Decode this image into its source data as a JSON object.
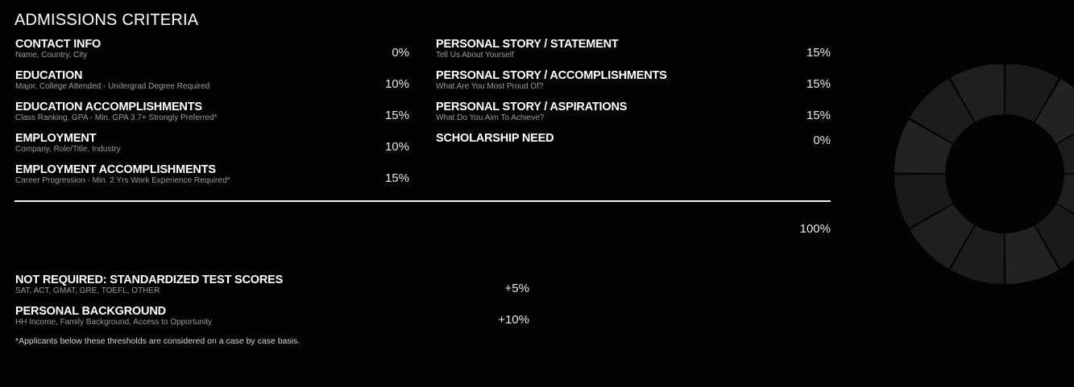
{
  "section": {
    "title": "ADMISSIONS CRITERIA"
  },
  "left_criteria": [
    {
      "label": "CONTACT INFO",
      "sub": "Name, Country, City",
      "pct": "0%"
    },
    {
      "label": "EDUCATION",
      "sub": "Major, College Attended - Undergrad Degree Required",
      "pct": "10%"
    },
    {
      "label": "EDUCATION ACCOMPLISHMENTS",
      "sub": "Class Ranking, GPA - Min. GPA 3.7+ Strongly Preferred*",
      "pct": "15%"
    },
    {
      "label": "EMPLOYMENT",
      "sub": "Company, Role/Title, Industry",
      "pct": "10%"
    },
    {
      "label": "EMPLOYMENT ACCOMPLISHMENTS",
      "sub": "Career Progression - Min. 2 Yrs Work Experience Required*",
      "pct": "15%"
    }
  ],
  "right_criteria": [
    {
      "label": "PERSONAL STORY / STATEMENT",
      "sub": "Tell Us About Yourself",
      "pct": "15%"
    },
    {
      "label": "PERSONAL STORY / ACCOMPLISHMENTS",
      "sub": "What Are You Most Proud Of?",
      "pct": "15%"
    },
    {
      "label": "PERSONAL STORY / ASPIRATIONS",
      "sub": "What Do You Aim To Achieve?",
      "pct": "15%"
    },
    {
      "label": "SCHOLARSHIP NEED",
      "sub": "",
      "pct": "0%"
    }
  ],
  "total": "100%",
  "extras": [
    {
      "label": "NOT REQUIRED: STANDARDIZED TEST SCORES",
      "sub": "SAT, ACT, GMAT, GRE, TOEFL, OTHER",
      "pct": "+5%"
    },
    {
      "label": "PERSONAL BACKGROUND",
      "sub": "HH Income, Family Background, Access to Opportunity",
      "pct": "+10%"
    }
  ],
  "footnote": "*Applicants below these thresholds are considered on a case by case basis.",
  "colors": {
    "background": "#030303",
    "text": "#ffffff",
    "subtext": "#9a9a9a",
    "donut_segments": [
      "#1a1a1a",
      "#222222",
      "#1c1c1c",
      "#1f1f1f"
    ]
  }
}
